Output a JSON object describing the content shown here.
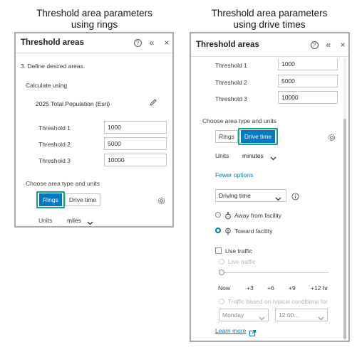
{
  "left_caption": {
    "line1": "Threshold area parameters",
    "line2": "using rings"
  },
  "right_caption": {
    "line1": "Threshold area parameters",
    "line2": "using drive times"
  },
  "left_panel": {
    "title": "Threshold areas",
    "help_glyph": "?",
    "collapse_glyph": "«",
    "close_glyph": "×",
    "step_label": "3.  Define desired areas.",
    "calculate_label": "Calculate using",
    "variable": "2025 Total Population (Esri)",
    "thresholds": [
      {
        "label": "Threshold 1",
        "value": "1000"
      },
      {
        "label": "Threshold 2",
        "value": "5000"
      },
      {
        "label": "Threshold 3",
        "value": "10000"
      }
    ],
    "area_type_label": "Choose area type and units",
    "rings_label": "Rings",
    "drive_time_label": "Drive time",
    "units_label": "Units",
    "units_value": "miles"
  },
  "right_panel": {
    "title": "Threshold areas",
    "help_glyph": "?",
    "collapse_glyph": "«",
    "close_glyph": "×",
    "thresholds": [
      {
        "label": "Threshold 1",
        "value": "1000"
      },
      {
        "label": "Threshold 2",
        "value": "5000"
      },
      {
        "label": "Threshold 3",
        "value": "10000"
      }
    ],
    "area_type_label": "Choose area type and units",
    "rings_label": "Rings",
    "drive_time_label": "Drive time",
    "units_label": "Units",
    "units_value": "minutes",
    "fewer_options": "Fewer options",
    "travel_mode": "Driving time",
    "away_label": "Away from facility",
    "toward_label": "Toward facility",
    "use_traffic": "Use traffic",
    "live_traffic": "Live traffic",
    "slider_ticks": [
      "Now",
      "+3",
      "+6",
      "+9",
      "+12 hr"
    ],
    "typical_traffic": "Traffic based on typical conditions for",
    "day_value": "Monday",
    "time_value": "12:00...",
    "learn_more": "Learn more"
  },
  "colors": {
    "accent": "#0079c1",
    "highlight": "#17a08c",
    "border": "#a9a9a9"
  }
}
